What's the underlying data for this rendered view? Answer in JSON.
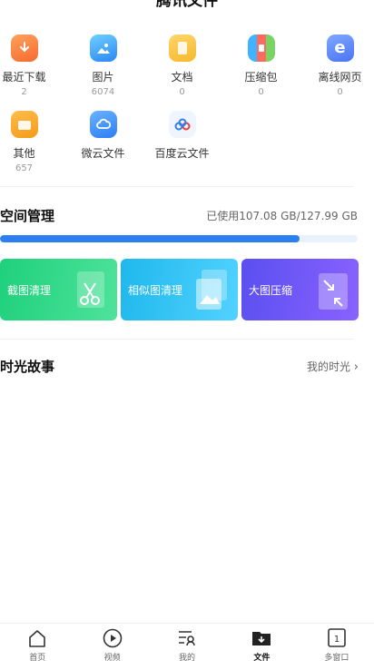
{
  "header": {
    "title": "腾讯文件"
  },
  "categories": [
    {
      "label": "最近下载",
      "count": "2",
      "icon": "download-icon"
    },
    {
      "label": "图片",
      "count": "6074",
      "icon": "image-icon"
    },
    {
      "label": "文档",
      "count": "0",
      "icon": "document-icon"
    },
    {
      "label": "压缩包",
      "count": "0",
      "icon": "archive-icon"
    },
    {
      "label": "离线网页",
      "count": "0",
      "icon": "web-icon"
    },
    {
      "label": "其他",
      "count": "657",
      "icon": "folder-icon"
    },
    {
      "label": "微云文件",
      "count": "",
      "icon": "weiyun-cloud-icon"
    },
    {
      "label": "百度云文件",
      "count": "",
      "icon": "baidu-cloud-icon"
    }
  ],
  "storage": {
    "title": "空间管理",
    "usage_text": "已使用107.08 GB/127.99 GB",
    "used_fraction": 0.837,
    "accent": "#2b7ff0"
  },
  "cleanup_cards": [
    {
      "label": "截图清理",
      "icon": "scissors-icon"
    },
    {
      "label": "相似图清理",
      "icon": "image-stack-icon"
    },
    {
      "label": "大图压缩",
      "icon": "compress-icon"
    }
  ],
  "story": {
    "title": "时光故事",
    "link": "我的时光"
  },
  "tabbar": [
    {
      "label": "首页",
      "icon": "home-icon"
    },
    {
      "label": "视频",
      "icon": "play-icon"
    },
    {
      "label": "我的",
      "icon": "profile-icon"
    },
    {
      "label": "文件",
      "icon": "file-folder-icon",
      "active": true
    },
    {
      "label": "多窗口",
      "icon": "windows-icon"
    }
  ]
}
